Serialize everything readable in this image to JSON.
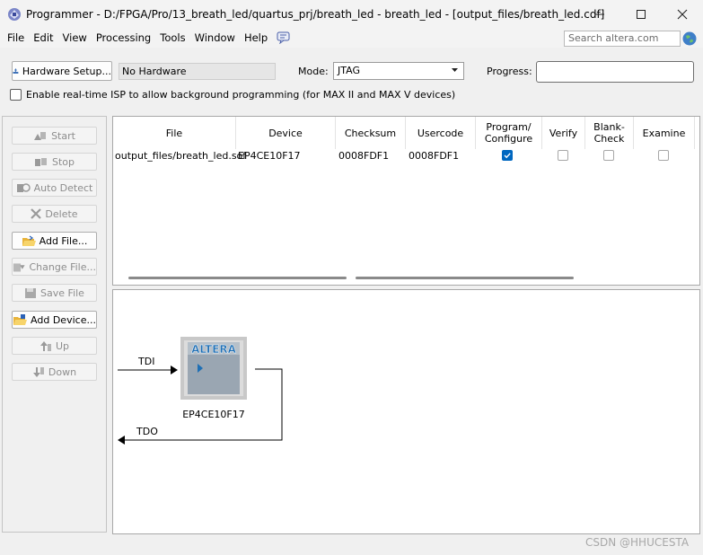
{
  "window": {
    "title": "Programmer - D:/FPGA/Pro/13_breath_led/quartus_prj/breath_led - breath_led - [output_files/breath_led.cdf]"
  },
  "menu": {
    "items": [
      "File",
      "Edit",
      "View",
      "Processing",
      "Tools",
      "Window",
      "Help"
    ],
    "search_placeholder": "Search altera.com"
  },
  "toolbar": {
    "hardware_setup_label": "Hardware Setup...",
    "hardware_value": "No Hardware",
    "mode_label": "Mode:",
    "mode_value": "JTAG",
    "progress_label": "Progress:",
    "progress_value": 0,
    "isp_label": "Enable real-time ISP to allow background programming (for MAX II and MAX V devices)",
    "isp_checked": false
  },
  "side_buttons": [
    {
      "label": "Start",
      "enabled": false
    },
    {
      "label": "Stop",
      "enabled": false
    },
    {
      "label": "Auto Detect",
      "enabled": false
    },
    {
      "label": "Delete",
      "enabled": false
    },
    {
      "label": "Add File...",
      "enabled": true
    },
    {
      "label": "Change File...",
      "enabled": false
    },
    {
      "label": "Save File",
      "enabled": false
    },
    {
      "label": "Add Device...",
      "enabled": true
    },
    {
      "label": "Up",
      "enabled": false
    },
    {
      "label": "Down",
      "enabled": false
    }
  ],
  "table": {
    "columns": [
      "File",
      "Device",
      "Checksum",
      "Usercode",
      "Program/\nConfigure",
      "Verify",
      "Blank-\nCheck",
      "Examine"
    ],
    "rows": [
      {
        "file": "output_files/breath_led.sof",
        "device": "EP4CE10F17",
        "checksum": "0008FDF1",
        "usercode": "0008FDF1",
        "program": true,
        "verify": false,
        "blank_check": false,
        "examine": false
      }
    ]
  },
  "chain": {
    "tdi_label": "TDI",
    "tdo_label": "TDO",
    "chip_logo": "ALTERA",
    "device_label": "EP4CE10F17"
  },
  "watermark": "CSDN @HHUCESTA",
  "colors": {
    "accent": "#0067c0",
    "chip": "#9aa6b2",
    "logo": "#1e6fb5"
  }
}
